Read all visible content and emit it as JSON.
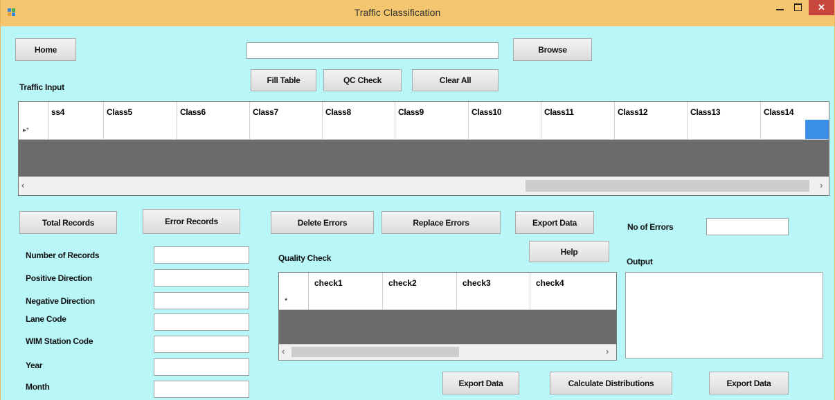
{
  "window": {
    "title": "Traffic Classification",
    "close_glyph": "✕"
  },
  "top": {
    "home_label": "Home",
    "browse_label": "Browse",
    "path_value": ""
  },
  "actions": {
    "fill_table": "Fill Table",
    "qc_check": "QC Check",
    "clear_all": "Clear All"
  },
  "traffic_input": {
    "label": "Traffic Input",
    "row_marker": "▸*",
    "columns": [
      "ss4",
      "Class5",
      "Class6",
      "Class7",
      "Class8",
      "Class9",
      "Class10",
      "Class11",
      "Class12",
      "Class13",
      "Class14"
    ]
  },
  "mid_buttons": {
    "total_records": "Total Records",
    "error_records": "Error Records",
    "delete_errors": "Delete Errors",
    "replace_errors": "Replace Errors",
    "export_data": "Export Data",
    "help": "Help"
  },
  "errors": {
    "label": "No of Errors",
    "value": ""
  },
  "fields": [
    {
      "label": "Number of Records",
      "value": ""
    },
    {
      "label": "Positive Direction",
      "value": ""
    },
    {
      "label": "Negative Direction",
      "value": ""
    },
    {
      "label": "Lane Code",
      "value": ""
    },
    {
      "label": "WIM Station Code",
      "value": ""
    },
    {
      "label": "Year",
      "value": ""
    },
    {
      "label": "Month",
      "value": ""
    }
  ],
  "quality_check": {
    "label": "Quality Check",
    "row_marker": "*",
    "columns": [
      "check1",
      "check2",
      "check3",
      "check4"
    ]
  },
  "output": {
    "label": "Output",
    "value": ""
  },
  "bottom_buttons": {
    "export_data_1": "Export Data",
    "calculate": "Calculate Distributions",
    "export_data_2": "Export Data"
  },
  "colors": {
    "background": "#b9f6f8",
    "titlebar": "#f3c66f",
    "close": "#c7473c",
    "selected_cell": "#3b8fe6"
  }
}
